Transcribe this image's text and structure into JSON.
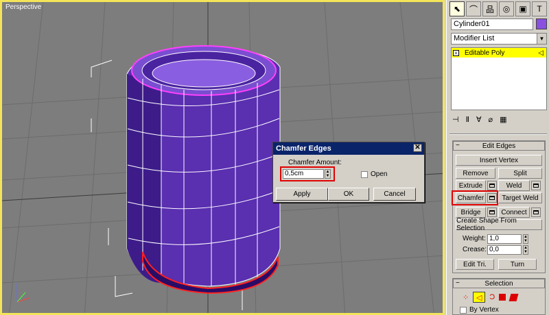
{
  "viewport": {
    "label": "Perspective"
  },
  "panel": {
    "tabs": [
      "select-tab",
      "create-tab",
      "hierarchy-tab",
      "motion-tab",
      "display-tab",
      "utilities-tab"
    ],
    "object_name": "Cylinder01",
    "object_color": "#8a50e0",
    "modifier_list": "Modifier List",
    "stack_item": "Editable Poly",
    "edit_edges": {
      "title": "Edit Edges",
      "insert_vertex": "Insert Vertex",
      "remove": "Remove",
      "split": "Split",
      "extrude": "Extrude",
      "weld": "Weld",
      "chamfer": "Chamfer",
      "target_weld": "Target Weld",
      "bridge": "Bridge",
      "connect": "Connect",
      "create_shape": "Create Shape From Selection",
      "weight_label": "Weight:",
      "weight_value": "1,0",
      "crease_label": "Crease:",
      "crease_value": "0,0",
      "edit_tri": "Edit Tri.",
      "turn": "Turn"
    },
    "selection": {
      "title": "Selection",
      "by_vertex": "By Vertex"
    }
  },
  "dialog": {
    "title": "Chamfer Edges",
    "amount_label": "Chamfer Amount:",
    "amount_value": "0,5cm",
    "open_label": "Open",
    "apply": "Apply",
    "ok": "OK",
    "cancel": "Cancel"
  }
}
